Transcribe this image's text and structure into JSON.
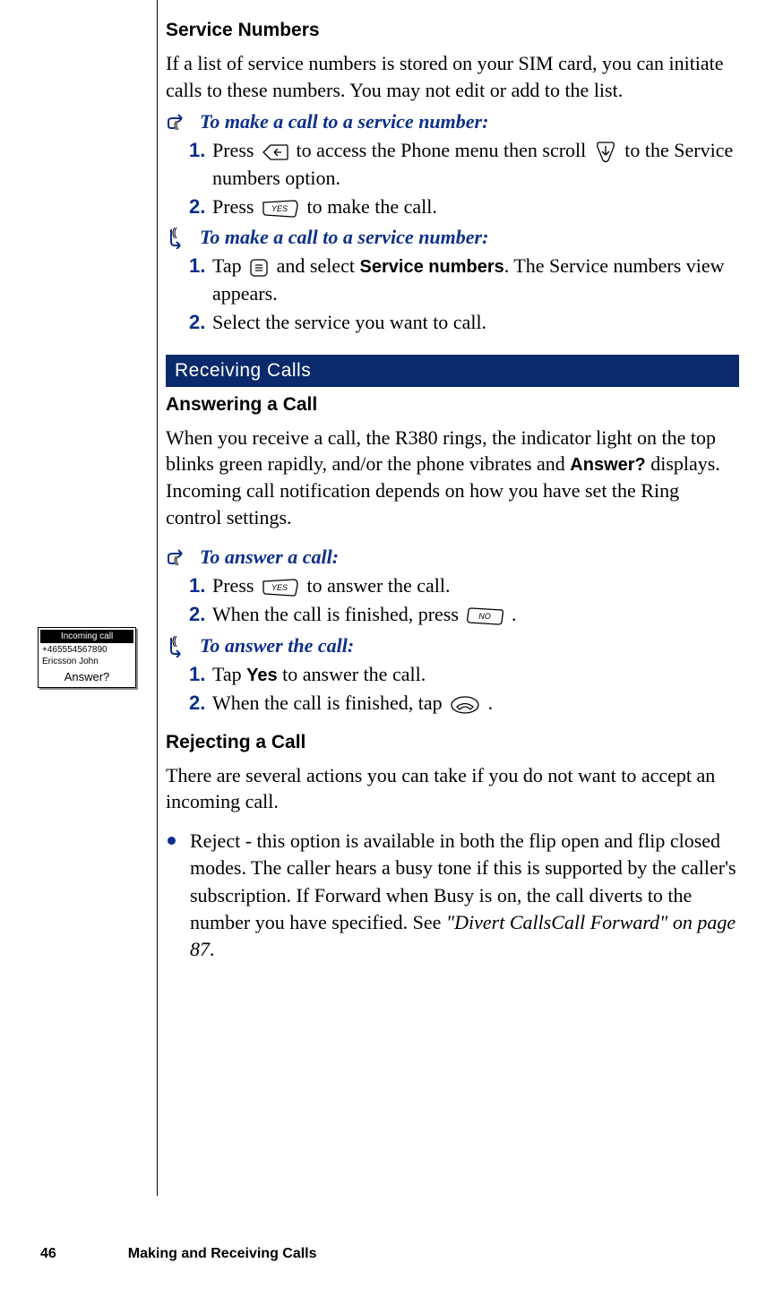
{
  "section1": {
    "heading": "Service Numbers",
    "intro": "If a list of service numbers is stored on your SIM card, you can initiate calls to these numbers. You may not edit or add to the list."
  },
  "proc1": {
    "title": "To make a call to a service number:",
    "step1_pre": "Press ",
    "step1_mid": " to access the Phone menu then scroll ",
    "step1_post": " to the Service numbers option.",
    "step2_pre": "Press ",
    "step2_post": " to make the call."
  },
  "proc2": {
    "title": "To make a call to a service number:",
    "step1_pre": "Tap ",
    "step1_mid": " and select ",
    "step1_label": "Service numbers",
    "step1_post": ". The Service numbers view appears.",
    "step2": "Select the service you want to call."
  },
  "bar1": "Receiving Calls",
  "section2": {
    "heading": "Answering a Call",
    "p_pre": "When you receive a call, the R380 rings, the indicator light on the top blinks green rapidly, and/or the phone vibrates and ",
    "p_label": "Answer?",
    "p_post": " displays. Incoming call notification depends on how you have set the Ring control settings."
  },
  "proc3": {
    "title": "To answer a call:",
    "step1_pre": "Press ",
    "step1_post": " to answer the call.",
    "step2_pre": "When the call is finished, press ",
    "step2_post": "."
  },
  "proc4": {
    "title": "To answer the call:",
    "step1_pre": "Tap ",
    "step1_label": "Yes",
    "step1_post": " to answer the call.",
    "step2_pre": "When the call is finished, tap ",
    "step2_post": " ."
  },
  "section3": {
    "heading": "Rejecting a Call",
    "intro": "There are several actions you can take if you do not want to accept an incoming call."
  },
  "bullet1": {
    "label": "Reject",
    "text1": " - this option is available in both the flip open and flip closed modes. The caller hears a busy tone if this is supported by the caller's subscription. If ",
    "label2": "Forward when Busy",
    "text2": " is on, the call diverts to the number you have specified. See ",
    "ref": "\"Divert CallsCall Forward\" on page 87",
    "text3": "."
  },
  "phone_screen": {
    "title": "Incoming call",
    "number": "+465554567890",
    "name": "Ericsson John",
    "prompt": "Answer?"
  },
  "footer": {
    "page": "46",
    "chapter": "Making and Receiving Calls"
  },
  "nums": {
    "s1": "1.",
    "s2": "2."
  }
}
